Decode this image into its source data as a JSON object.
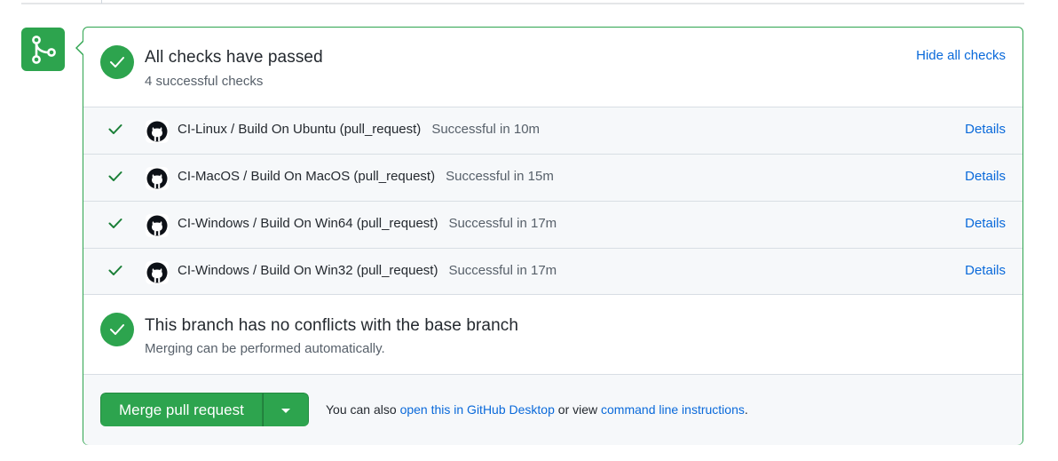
{
  "checks_summary": {
    "title": "All checks have passed",
    "subtitle": "4 successful checks",
    "hide_link": "Hide all checks"
  },
  "checks": [
    {
      "name": "CI-Linux / Build On Ubuntu (pull_request)",
      "status": "Successful in 10m",
      "details": "Details"
    },
    {
      "name": "CI-MacOS / Build On MacOS (pull_request)",
      "status": "Successful in 15m",
      "details": "Details"
    },
    {
      "name": "CI-Windows / Build On Win64 (pull_request)",
      "status": "Successful in 17m",
      "details": "Details"
    },
    {
      "name": "CI-Windows / Build On Win32 (pull_request)",
      "status": "Successful in 17m",
      "details": "Details"
    }
  ],
  "conflicts": {
    "title": "This branch has no conflicts with the base branch",
    "subtitle": "Merging can be performed automatically."
  },
  "merge": {
    "button_label": "Merge pull request",
    "help_prefix": "You can also ",
    "desktop_link": "open this in GitHub Desktop",
    "help_middle": " or view ",
    "cli_link": "command line instructions",
    "help_suffix": "."
  },
  "icons": {
    "merge": "git-merge-icon",
    "status": "check-circle-icon",
    "check": "check-icon",
    "app": "github-logo-icon",
    "dropdown": "caret-down-icon"
  },
  "colors": {
    "success": "#2da44e",
    "link": "#0969da",
    "muted": "#57606a"
  }
}
